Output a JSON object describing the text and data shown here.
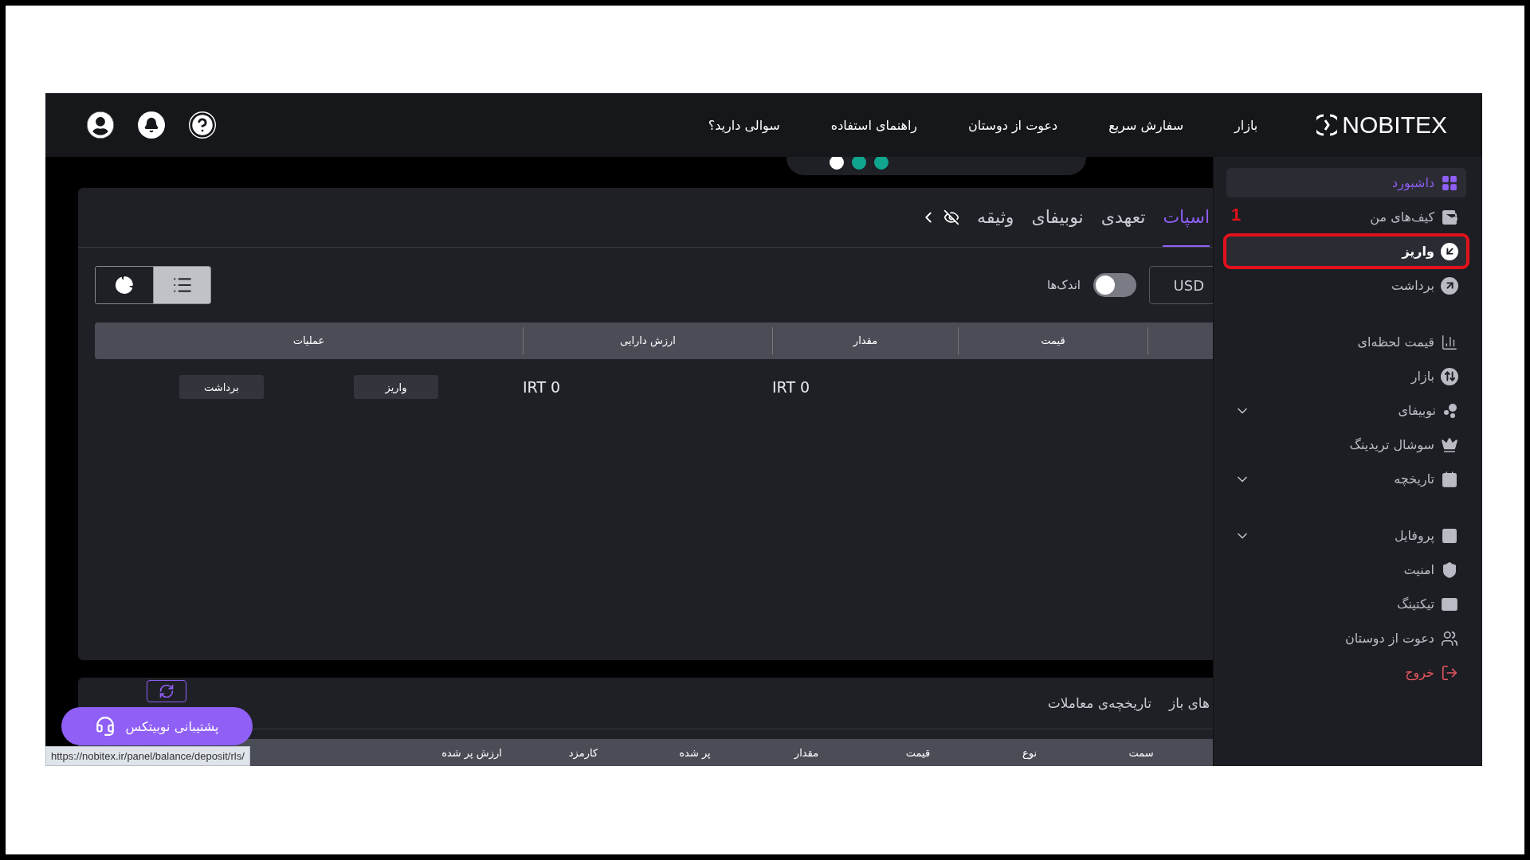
{
  "header": {
    "logo": "NOBITEX",
    "nav": [
      "بازار",
      "سفارش سریع",
      "دعوت از دوستان",
      "راهنمای استفاده",
      "سوالی دارید؟"
    ]
  },
  "sidebar": {
    "groups": [
      {
        "items": [
          {
            "label": "داشبورد",
            "kind": "link",
            "selected": true,
            "hovered": false
          },
          {
            "label": "کیف‌های من",
            "kind": "link",
            "selected": false,
            "hovered": false
          },
          {
            "label": "واریز",
            "kind": "link",
            "selected": false,
            "hovered": true,
            "annotation": "1"
          },
          {
            "label": "برداشت",
            "kind": "link",
            "selected": false,
            "hovered": false
          }
        ]
      },
      {
        "items": [
          {
            "label": "قیمت لحظه‌ای",
            "kind": "link",
            "selected": false,
            "hovered": false
          },
          {
            "label": "بازار",
            "kind": "link",
            "selected": false,
            "hovered": false
          },
          {
            "label": "نوبیفای",
            "kind": "link",
            "selected": false,
            "hovered": false,
            "expanded": false
          },
          {
            "label": "سوشال تریدینگ",
            "kind": "link",
            "selected": false,
            "hovered": false
          },
          {
            "label": "تاریخچه",
            "kind": "link",
            "selected": false,
            "hovered": false,
            "expanded": false
          }
        ]
      },
      {
        "items": [
          {
            "label": "پروفایل",
            "kind": "link",
            "selected": false,
            "hovered": false,
            "expanded": false
          },
          {
            "label": "امنیت",
            "kind": "link",
            "selected": false,
            "hovered": false
          },
          {
            "label": "تیکتینگ",
            "kind": "link",
            "selected": false,
            "hovered": false
          },
          {
            "label": "دعوت از دوستان",
            "kind": "link",
            "selected": false,
            "hovered": false
          },
          {
            "label": "خروج",
            "kind": "logout",
            "selected": false,
            "hovered": false
          }
        ]
      }
    ]
  },
  "assets": {
    "tabs": [
      {
        "label": "اسپات",
        "selected": true
      },
      {
        "label": "تعهدی",
        "selected": false
      },
      {
        "label": "نوبیفای",
        "selected": false
      },
      {
        "label": "وثیقه",
        "selected": false
      }
    ],
    "currency": "USD",
    "small_balances": {
      "label": "اندک‌ها",
      "on": false
    },
    "views": [
      {
        "kind": "list",
        "selected": true
      },
      {
        "kind": "pie",
        "selected": false
      }
    ],
    "table": {
      "columns": [
        "قیمت",
        "مقدار",
        "ارزش دارایی",
        "عملیات"
      ],
      "rows": [
        {
          "amount": "IRT 0",
          "value": "IRT 0",
          "actions": [
            "واریز",
            "برداشت"
          ]
        }
      ]
    }
  },
  "orders": {
    "tabs": [
      {
        "label": "های باز"
      },
      {
        "label": "تاریخچه‌ی معاملات"
      }
    ],
    "columns": [
      "سمت",
      "نوع",
      "قیمت",
      "مقدار",
      "پر شده",
      "کارمزد",
      "ارزش پر شده"
    ]
  },
  "support": {
    "label": "پشتیبانی نوبیتکس"
  },
  "status_url": "https://nobitex.ir/panel/balance/deposit/rls/"
}
